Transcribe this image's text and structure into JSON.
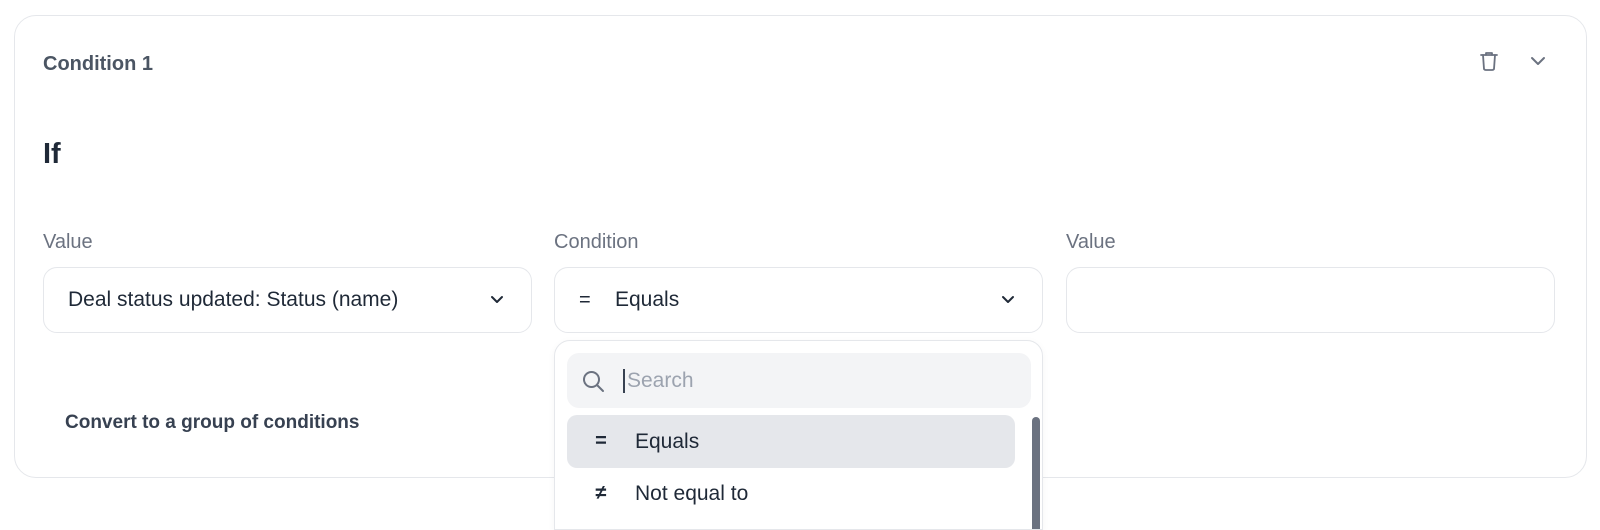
{
  "condition_card": {
    "title": "Condition 1",
    "icons": {
      "delete": "trash-icon",
      "collapse": "chevron-down-icon"
    },
    "if_heading": "If",
    "left_value": {
      "label": "Value",
      "selected": "Deal status updated: Status (name)"
    },
    "condition": {
      "label": "Condition",
      "selected_symbol": "=",
      "selected": "Equals"
    },
    "right_value": {
      "label": "Value",
      "value": ""
    },
    "convert_link": "Convert to a group of conditions"
  },
  "condition_dropdown": {
    "search_placeholder": "Search",
    "search_value": "",
    "options": [
      {
        "symbol": "=",
        "label": "Equals",
        "selected": true
      },
      {
        "symbol": "≠",
        "label": "Not equal to",
        "selected": false
      }
    ]
  },
  "colors": {
    "border": "#e5e7eb",
    "label_gray": "#6b7280",
    "selected_bg": "#e5e7eb",
    "search_bg": "#f3f4f6"
  }
}
